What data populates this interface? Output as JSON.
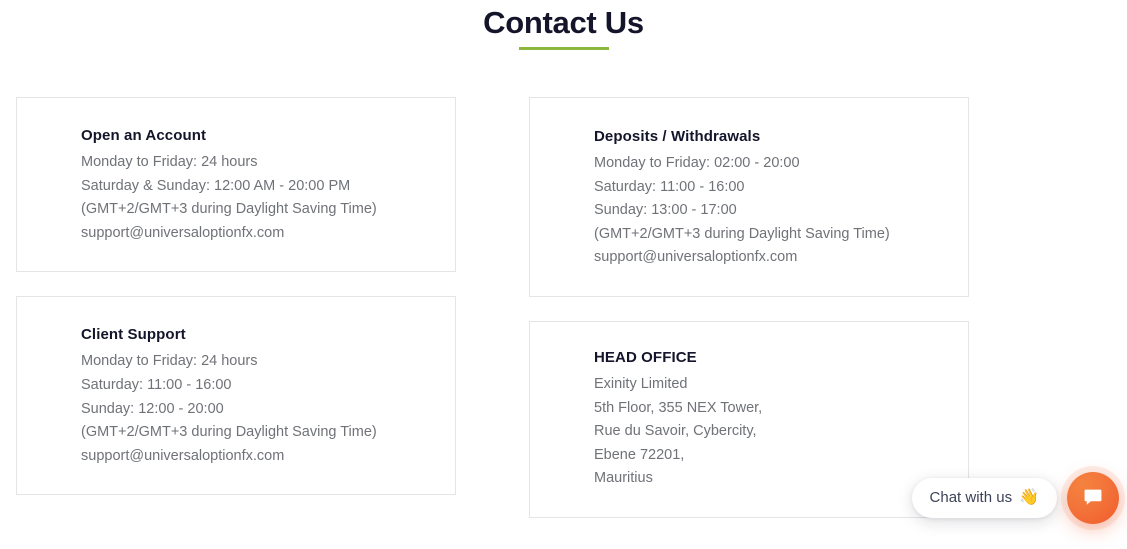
{
  "header": {
    "title": "Contact Us",
    "underline_color": "#8CB63C"
  },
  "cards": {
    "left": [
      {
        "title": "Open an Account",
        "lines": [
          "Monday to Friday: 24 hours",
          "Saturday & Sunday: 12:00 AM - 20:00 PM",
          "(GMT+2/GMT+3 during Daylight Saving Time)",
          "support@universaloptionfx.com"
        ]
      },
      {
        "title": "Client Support",
        "lines": [
          "Monday to Friday: 24 hours",
          "Saturday: 11:00 - 16:00",
          "Sunday: 12:00 - 20:00",
          "(GMT+2/GMT+3 during Daylight Saving Time)",
          "support@universaloptionfx.com"
        ]
      }
    ],
    "right": [
      {
        "title": "Deposits / Withdrawals",
        "lines": [
          "Monday to Friday: 02:00 - 20:00",
          "Saturday: 11:00 - 16:00",
          "Sunday: 13:00 - 17:00",
          "(GMT+2/GMT+3 during Daylight Saving Time)",
          "support@universaloptionfx.com"
        ]
      },
      {
        "title": "HEAD OFFICE",
        "lines": [
          "Exinity Limited",
          "5th Floor, 355 NEX Tower,",
          "Rue du Savoir, Cybercity,",
          "Ebene 72201,",
          "Mauritius"
        ]
      }
    ]
  },
  "chat_widget": {
    "pill_text": "Chat with us",
    "pill_emoji": "👋",
    "button_icon": "chat-bubble-icon",
    "button_color": "#F05A2B"
  }
}
